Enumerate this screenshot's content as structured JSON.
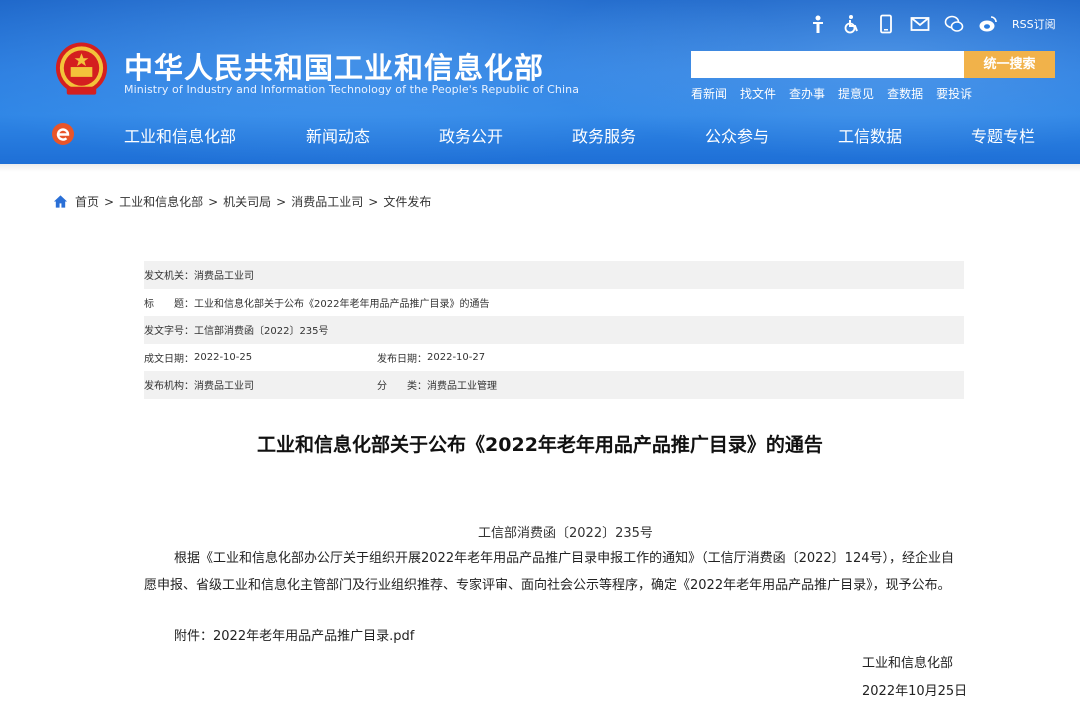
{
  "header": {
    "site_title": "中华人民共和国工业和信息化部",
    "site_subtitle": "Ministry of Industry and Information Technology of the People's Republic of China",
    "rss_label": "RSS订阅",
    "search": {
      "placeholder": "",
      "button_label": "统一搜索"
    },
    "quick_links": [
      "看新闻",
      "找文件",
      "查办事",
      "提意见",
      "查数据",
      "要投诉"
    ],
    "nav": [
      "工业和信息化部",
      "新闻动态",
      "政务公开",
      "政务服务",
      "公众参与",
      "工信数据",
      "专题专栏"
    ],
    "top_icons": [
      "accessibility-person-icon",
      "wheelchair-icon",
      "mobile-phone-icon",
      "mail-icon",
      "wechat-icon",
      "weibo-icon"
    ],
    "colors": {
      "header_blue": "#2a7de0",
      "search_button": "#f1b24a"
    }
  },
  "breadcrumb": [
    "首页",
    "工业和信息化部",
    "机关司局",
    "消费品工业司",
    "文件发布"
  ],
  "meta": {
    "issuer_label": "发文机关：",
    "issuer_value": "消费品工业司",
    "title_label": "标　　题：",
    "title_value": "工业和信息化部关于公布《2022年老年用品产品推广目录》的通告",
    "doc_no_label": "发文字号：",
    "doc_no_value": "工信部消费函〔2022〕235号",
    "created_label": "成文日期：",
    "created_value": "2022-10-25",
    "published_label": "发布日期：",
    "published_value": "2022-10-27",
    "agency_label": "发布机构：",
    "agency_value": "消费品工业司",
    "category_label": "分　　类：",
    "category_value": "消费品工业管理"
  },
  "article": {
    "title": "工业和信息化部关于公布《2022年老年用品产品推广目录》的通告",
    "doc_number": "工信部消费函〔2022〕235号",
    "paragraph": "根据《工业和信息化部办公厅关于组织开展2022年老年用品产品推广目录申报工作的通知》（工信厅消费函〔2022〕124号），经企业自愿申报、省级工业和信息化主管部门及行业组织推荐、专家评审、面向社会公示等程序，确定《2022年老年用品产品推广目录》，现予公布。",
    "attachment": "附件：2022年老年用品产品推广目录.pdf",
    "sign_org": "工业和信息化部",
    "sign_date": "2022年10月25日"
  }
}
